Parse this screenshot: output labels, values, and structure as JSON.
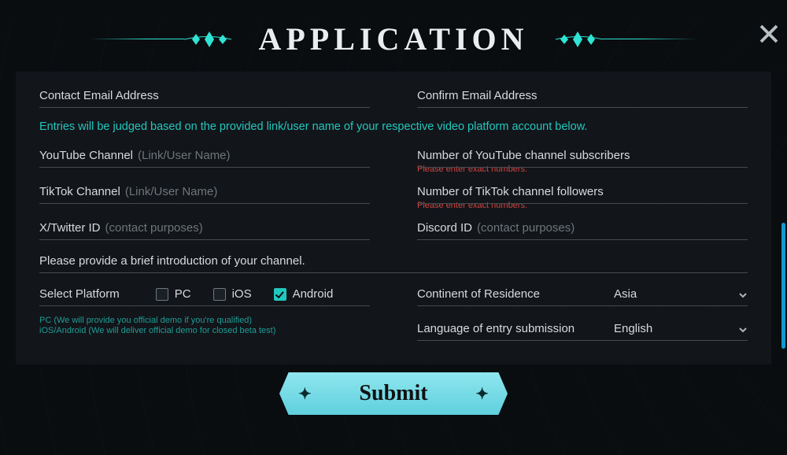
{
  "title": "APPLICATION",
  "close_icon": "close",
  "info_text": "Entries will be judged based on the provided link/user name of your respective video platform account below.",
  "fields": {
    "contact_email_label": "Contact Email Address",
    "confirm_email_label": "Confirm Email Address",
    "youtube_label": "YouTube Channel",
    "youtube_hint": "(Link/User Name)",
    "youtube_subs_label": "Number of YouTube channel subscribers",
    "youtube_subs_err": "Please enter exact numbers.",
    "tiktok_label": "TikTok Channel",
    "tiktok_hint": "(Link/User Name)",
    "tiktok_foll_label": "Number of TikTok channel followers",
    "tiktok_foll_err": "Please enter exact numbers.",
    "twitter_label": "X/Twitter ID",
    "twitter_hint": "(contact purposes)",
    "discord_label": "Discord ID",
    "discord_hint": "(contact purposes)",
    "intro_label": "Please provide a brief introduction of your channel."
  },
  "platform": {
    "label": "Select Platform",
    "options": {
      "pc": "PC",
      "ios": "iOS",
      "android": "Android"
    },
    "checked": {
      "pc": false,
      "ios": false,
      "android": true
    },
    "note_pc": "PC (We will provide you official demo if you're qualified)",
    "note_mobile": "iOS/Android (We will deliver official demo for closed beta test)"
  },
  "selects": {
    "continent_label": "Continent of Residence",
    "continent_value": "Asia",
    "language_label": "Language of entry submission",
    "language_value": "English"
  },
  "submit_label": "Submit"
}
